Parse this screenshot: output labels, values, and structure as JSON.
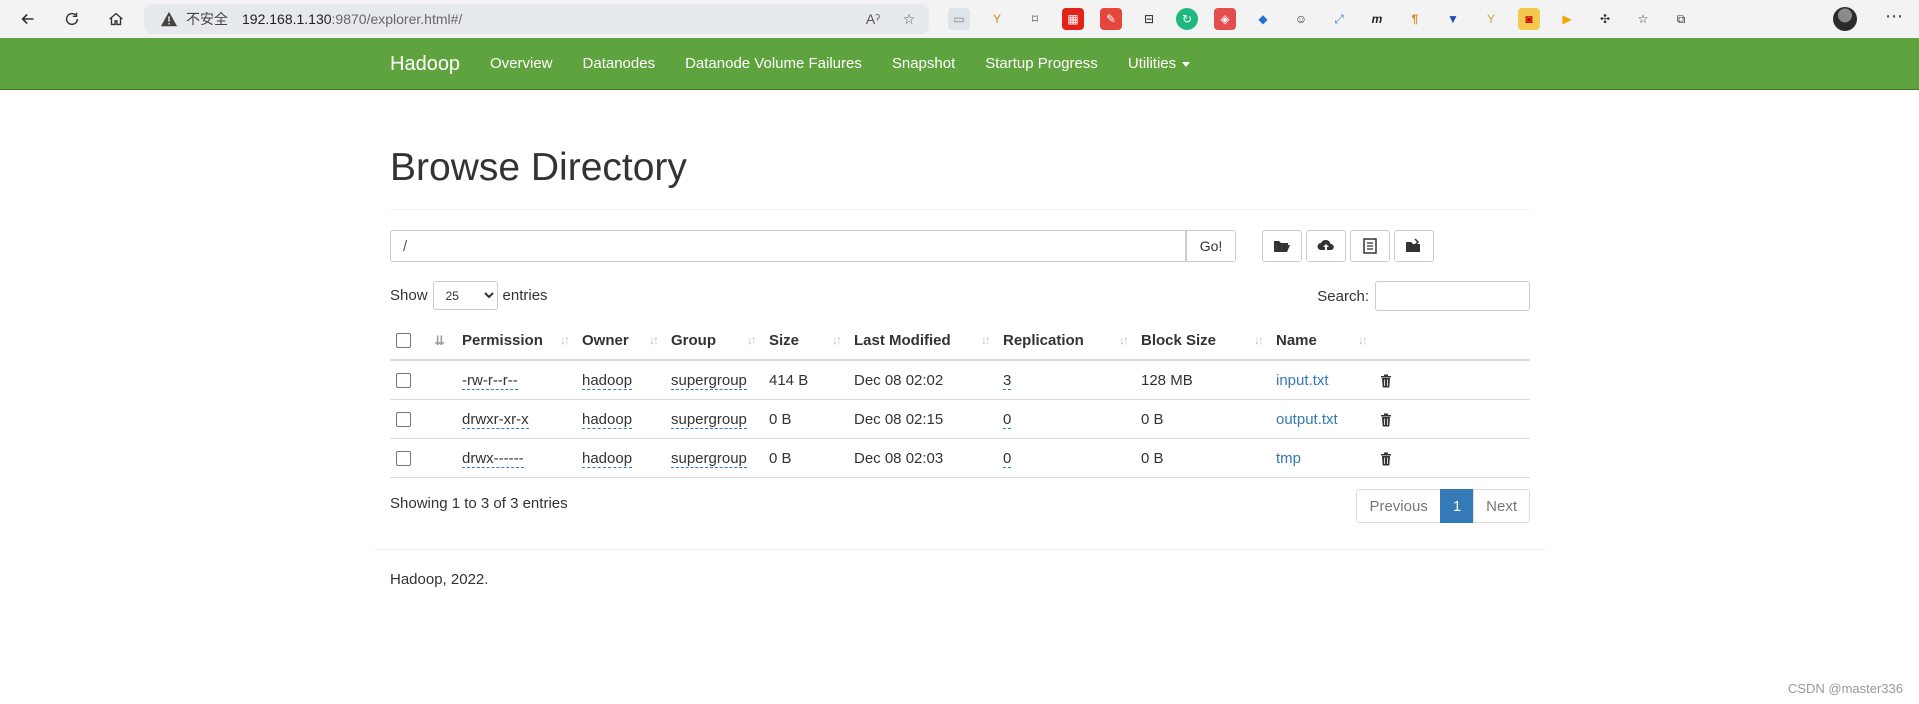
{
  "browser": {
    "insecure_label": "不安全",
    "url_host": "192.168.1.130",
    "url_path": ":9870/explorer.html#/"
  },
  "navbar": {
    "brand": "Hadoop",
    "items": [
      "Overview",
      "Datanodes",
      "Datanode Volume Failures",
      "Snapshot",
      "Startup Progress",
      "Utilities"
    ]
  },
  "page": {
    "title": "Browse Directory",
    "path_value": "/",
    "go_label": "Go!",
    "show_label": "Show",
    "entries_label": "entries",
    "page_size": "25",
    "search_label": "Search:",
    "info": "Showing 1 to 3 of 3 entries",
    "pager": {
      "previous": "Previous",
      "current": "1",
      "next": "Next"
    },
    "footer": "Hadoop, 2022."
  },
  "table": {
    "headers": [
      "Permission",
      "Owner",
      "Group",
      "Size",
      "Last Modified",
      "Replication",
      "Block Size",
      "Name"
    ],
    "rows": [
      {
        "permission": "-rw-r--r--",
        "owner": "hadoop",
        "group": "supergroup",
        "size": "414 B",
        "modified": "Dec 08 02:02",
        "replication": "3",
        "block_size": "128 MB",
        "name": "input.txt"
      },
      {
        "permission": "drwxr-xr-x",
        "owner": "hadoop",
        "group": "supergroup",
        "size": "0 B",
        "modified": "Dec 08 02:15",
        "replication": "0",
        "block_size": "0 B",
        "name": "output.txt"
      },
      {
        "permission": "drwx------",
        "owner": "hadoop",
        "group": "supergroup",
        "size": "0 B",
        "modified": "Dec 08 02:03",
        "replication": "0",
        "block_size": "0 B",
        "name": "tmp"
      }
    ]
  },
  "watermark": "CSDN @master336",
  "colors": {
    "navbar": "#5fa33e",
    "link": "#337ab7",
    "active_page": "#337ab7"
  }
}
